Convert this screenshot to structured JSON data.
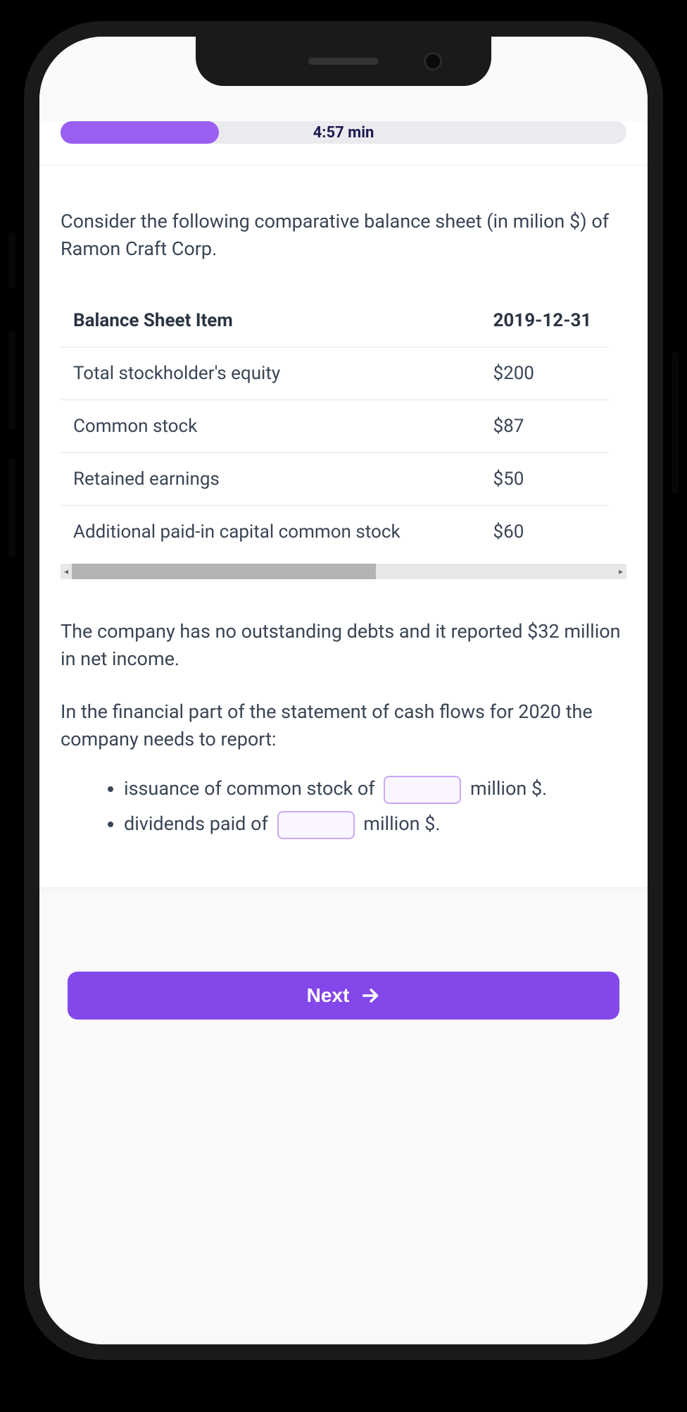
{
  "timer": "4:57 min",
  "progress_pct": 28,
  "prompt": "Consider the following comparative balance sheet (in milion $) of Ramon Craft Corp.",
  "table": {
    "headers": [
      "Balance Sheet Item",
      "2019-12-31"
    ],
    "rows": [
      [
        "Total stockholder's equity",
        "$200"
      ],
      [
        "Common stock",
        "$87"
      ],
      [
        "Retained earnings",
        "$50"
      ],
      [
        "Additional paid-in capital common stock",
        "$60"
      ]
    ]
  },
  "para1": "The company has no outstanding debts and it reported $32 million in net income.",
  "para2": "In the financial part of the statement of cash flows for 2020 the company needs to report:",
  "bullets": {
    "b1a": "issuance of common stock of ",
    "b1b": " million $.",
    "b2a": "dividends paid of ",
    "b2b": " million $."
  },
  "next_label": "Next"
}
